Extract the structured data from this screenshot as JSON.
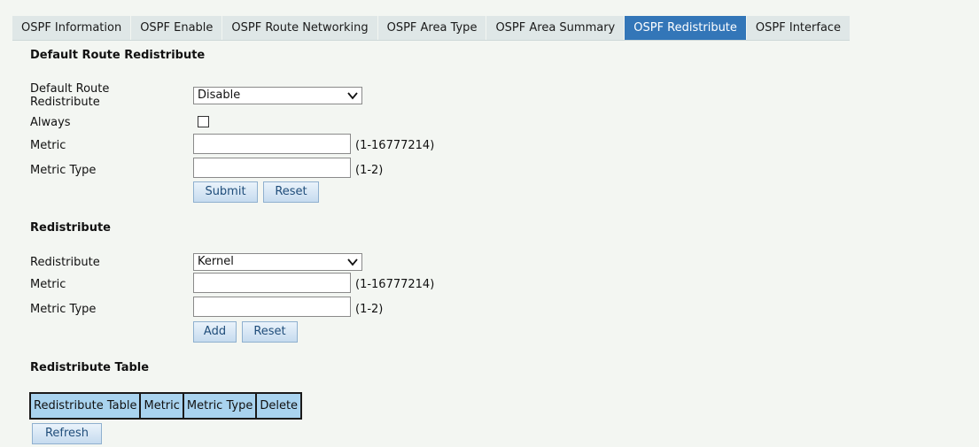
{
  "tabs": [
    {
      "label": "OSPF Information",
      "active": false
    },
    {
      "label": "OSPF Enable",
      "active": false
    },
    {
      "label": "OSPF Route Networking",
      "active": false
    },
    {
      "label": "OSPF Area Type",
      "active": false
    },
    {
      "label": "OSPF Area Summary",
      "active": false
    },
    {
      "label": "OSPF Redistribute",
      "active": true
    },
    {
      "label": "OSPF Interface",
      "active": false
    }
  ],
  "default_route": {
    "title": "Default Route Redistribute",
    "dr_label": "Default Route Redistribute",
    "dr_value": "Disable",
    "always_label": "Always",
    "always_checked": false,
    "metric_label": "Metric",
    "metric_value": "",
    "metric_range": "(1-16777214)",
    "metric_type_label": "Metric Type",
    "metric_type_value": "",
    "metric_type_range": "(1-2)",
    "submit_label": "Submit",
    "reset_label": "Reset"
  },
  "redistribute": {
    "title": "Redistribute",
    "redist_label": "Redistribute",
    "redist_value": "Kernel",
    "metric_label": "Metric",
    "metric_value": "",
    "metric_range": "(1-16777214)",
    "metric_type_label": "Metric Type",
    "metric_type_value": "",
    "metric_type_range": "(1-2)",
    "add_label": "Add",
    "reset_label": "Reset"
  },
  "table": {
    "title": "Redistribute Table",
    "headers": [
      "Redistribute Table",
      "Metric",
      "Metric Type",
      "Delete"
    ],
    "refresh_label": "Refresh"
  },
  "icons": {
    "dropdown": "chevron-down-icon"
  }
}
